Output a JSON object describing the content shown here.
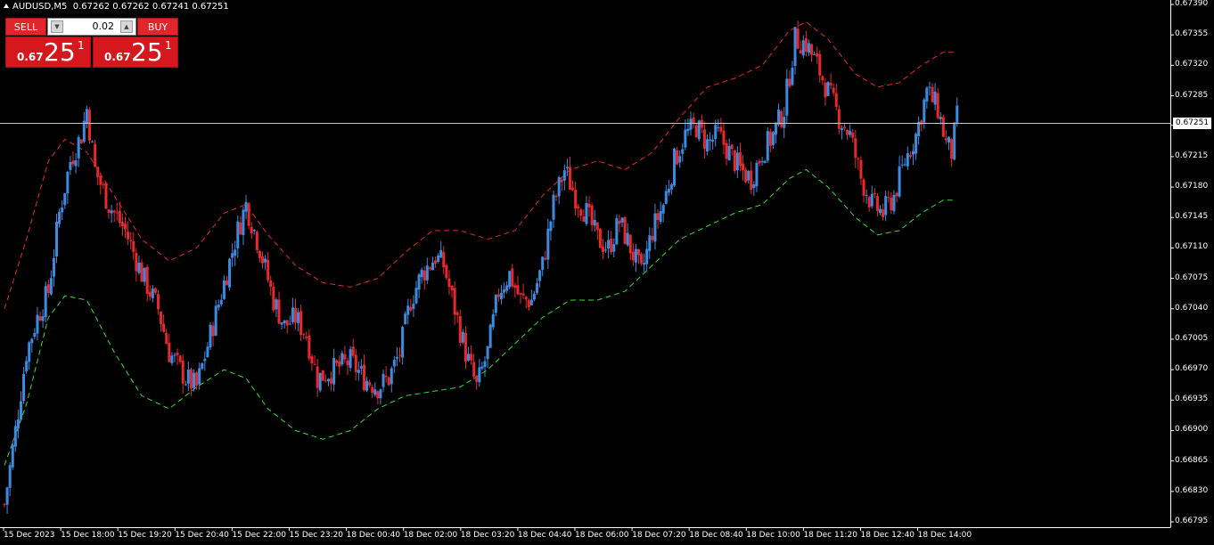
{
  "header": {
    "symbol": "AUDUSD,M5",
    "ohlc": "0.67262 0.67262 0.67241 0.67251"
  },
  "trade_panel": {
    "sell_label": "SELL",
    "buy_label": "BUY",
    "lot_size": "0.02",
    "sell_quote": {
      "prefix": "0.67",
      "big": "25",
      "sup": "1"
    },
    "buy_quote": {
      "prefix": "0.67",
      "big": "25",
      "sup": "1"
    }
  },
  "current_price": "0.67251",
  "colors": {
    "bull": "#3d8be0",
    "bear": "#e8282c",
    "upper_band": "#e8282c",
    "lower_band": "#32e032",
    "grid": "#fff"
  },
  "chart_data": {
    "type": "candlestick",
    "symbol": "AUDUSD",
    "timeframe": "M5",
    "ylim": [
      0.66795,
      0.6739
    ],
    "y_ticks": [
      "0.67390",
      "0.67355",
      "0.67320",
      "0.67285",
      "0.67251",
      "0.67215",
      "0.67180",
      "0.67145",
      "0.67110",
      "0.67075",
      "0.67040",
      "0.67005",
      "0.66970",
      "0.66935",
      "0.66900",
      "0.66865",
      "0.66830",
      "0.66795"
    ],
    "x_ticks": [
      "15 Dec 2023",
      "15 Dec 18:00",
      "15 Dec 19:20",
      "15 Dec 20:40",
      "15 Dec 22:00",
      "15 Dec 23:20",
      "18 Dec 00:40",
      "18 Dec 02:00",
      "18 Dec 03:20",
      "18 Dec 04:40",
      "18 Dec 06:00",
      "18 Dec 07:20",
      "18 Dec 08:40",
      "18 Dec 10:00",
      "18 Dec 11:20",
      "18 Dec 12:40",
      "18 Dec 14:00"
    ],
    "close_path": [
      [
        0,
        0.66815
      ],
      [
        4,
        0.669
      ],
      [
        8,
        0.6699
      ],
      [
        12,
        0.6703
      ],
      [
        16,
        0.6706
      ],
      [
        20,
        0.6715
      ],
      [
        24,
        0.6721
      ],
      [
        28,
        0.6724
      ],
      [
        30,
        0.6727
      ],
      [
        33,
        0.672
      ],
      [
        38,
        0.6716
      ],
      [
        44,
        0.6713
      ],
      [
        50,
        0.6708
      ],
      [
        56,
        0.6704
      ],
      [
        60,
        0.6699
      ],
      [
        66,
        0.6696
      ],
      [
        70,
        0.6695
      ],
      [
        75,
        0.6701
      ],
      [
        80,
        0.6707
      ],
      [
        85,
        0.6713
      ],
      [
        88,
        0.6716
      ],
      [
        93,
        0.6711
      ],
      [
        98,
        0.6705
      ],
      [
        102,
        0.6702
      ],
      [
        106,
        0.6703
      ],
      [
        110,
        0.6701
      ],
      [
        114,
        0.6696
      ],
      [
        120,
        0.6697
      ],
      [
        126,
        0.6698
      ],
      [
        131,
        0.6696
      ],
      [
        136,
        0.6695
      ],
      [
        140,
        0.6696
      ],
      [
        144,
        0.6699
      ],
      [
        148,
        0.6705
      ],
      [
        152,
        0.6708
      ],
      [
        157,
        0.671
      ],
      [
        160,
        0.6709
      ],
      [
        164,
        0.6704
      ],
      [
        168,
        0.6699
      ],
      [
        172,
        0.6695
      ],
      [
        176,
        0.6699
      ],
      [
        180,
        0.6706
      ],
      [
        184,
        0.6708
      ],
      [
        188,
        0.6705
      ],
      [
        192,
        0.6705
      ],
      [
        196,
        0.6709
      ],
      [
        200,
        0.6716
      ],
      [
        204,
        0.672
      ],
      [
        208,
        0.6717
      ],
      [
        212,
        0.6715
      ],
      [
        216,
        0.6712
      ],
      [
        220,
        0.6711
      ],
      [
        224,
        0.6714
      ],
      [
        228,
        0.6711
      ],
      [
        232,
        0.6708
      ],
      [
        236,
        0.6713
      ],
      [
        240,
        0.6716
      ],
      [
        244,
        0.6721
      ],
      [
        248,
        0.6724
      ],
      [
        252,
        0.6725
      ],
      [
        256,
        0.6723
      ],
      [
        260,
        0.6724
      ],
      [
        264,
        0.6722
      ],
      [
        268,
        0.672
      ],
      [
        272,
        0.6719
      ],
      [
        276,
        0.6722
      ],
      [
        280,
        0.6724
      ],
      [
        284,
        0.6727
      ],
      [
        288,
        0.6735
      ],
      [
        292,
        0.67345
      ],
      [
        296,
        0.6732
      ],
      [
        300,
        0.6729
      ],
      [
        304,
        0.6726
      ],
      [
        308,
        0.6724
      ],
      [
        312,
        0.6719
      ],
      [
        316,
        0.6716
      ],
      [
        320,
        0.6715
      ],
      [
        324,
        0.6717
      ],
      [
        328,
        0.6721
      ],
      [
        332,
        0.6724
      ],
      [
        336,
        0.6729
      ],
      [
        340,
        0.6727
      ],
      [
        343,
        0.6723
      ],
      [
        345,
        0.6722
      ],
      [
        347,
        0.6726
      ]
    ],
    "upper_band_path": [
      [
        0,
        0.6704
      ],
      [
        8,
        0.6712
      ],
      [
        16,
        0.6721
      ],
      [
        22,
        0.67235
      ],
      [
        30,
        0.6722
      ],
      [
        40,
        0.6717
      ],
      [
        50,
        0.6712
      ],
      [
        60,
        0.67095
      ],
      [
        70,
        0.6711
      ],
      [
        80,
        0.6715
      ],
      [
        88,
        0.6716
      ],
      [
        96,
        0.67125
      ],
      [
        106,
        0.6709
      ],
      [
        116,
        0.6707
      ],
      [
        126,
        0.67065
      ],
      [
        136,
        0.67075
      ],
      [
        146,
        0.67105
      ],
      [
        156,
        0.6713
      ],
      [
        166,
        0.6713
      ],
      [
        176,
        0.6712
      ],
      [
        186,
        0.6713
      ],
      [
        196,
        0.6717
      ],
      [
        206,
        0.672
      ],
      [
        216,
        0.6721
      ],
      [
        226,
        0.672
      ],
      [
        236,
        0.6722
      ],
      [
        246,
        0.6726
      ],
      [
        256,
        0.67295
      ],
      [
        266,
        0.67305
      ],
      [
        276,
        0.6732
      ],
      [
        286,
        0.6736
      ],
      [
        292,
        0.6737
      ],
      [
        300,
        0.6735
      ],
      [
        310,
        0.6731
      ],
      [
        318,
        0.67295
      ],
      [
        326,
        0.673
      ],
      [
        334,
        0.6732
      ],
      [
        342,
        0.67335
      ],
      [
        346,
        0.67335
      ]
    ],
    "lower_band_path": [
      [
        0,
        0.6686
      ],
      [
        8,
        0.6693
      ],
      [
        16,
        0.6703
      ],
      [
        22,
        0.67055
      ],
      [
        30,
        0.6705
      ],
      [
        40,
        0.6699
      ],
      [
        50,
        0.6694
      ],
      [
        60,
        0.66925
      ],
      [
        70,
        0.6695
      ],
      [
        80,
        0.6697
      ],
      [
        88,
        0.6696
      ],
      [
        96,
        0.66925
      ],
      [
        106,
        0.669
      ],
      [
        116,
        0.6689
      ],
      [
        126,
        0.669
      ],
      [
        136,
        0.66925
      ],
      [
        146,
        0.6694
      ],
      [
        156,
        0.66945
      ],
      [
        166,
        0.6695
      ],
      [
        176,
        0.6697
      ],
      [
        186,
        0.67
      ],
      [
        196,
        0.6703
      ],
      [
        206,
        0.6705
      ],
      [
        216,
        0.6705
      ],
      [
        226,
        0.6706
      ],
      [
        236,
        0.6709
      ],
      [
        246,
        0.6712
      ],
      [
        256,
        0.67135
      ],
      [
        266,
        0.6715
      ],
      [
        276,
        0.6716
      ],
      [
        286,
        0.6719
      ],
      [
        292,
        0.672
      ],
      [
        300,
        0.6718
      ],
      [
        310,
        0.67145
      ],
      [
        318,
        0.67125
      ],
      [
        326,
        0.6713
      ],
      [
        334,
        0.6715
      ],
      [
        342,
        0.67165
      ],
      [
        346,
        0.67165
      ]
    ]
  }
}
